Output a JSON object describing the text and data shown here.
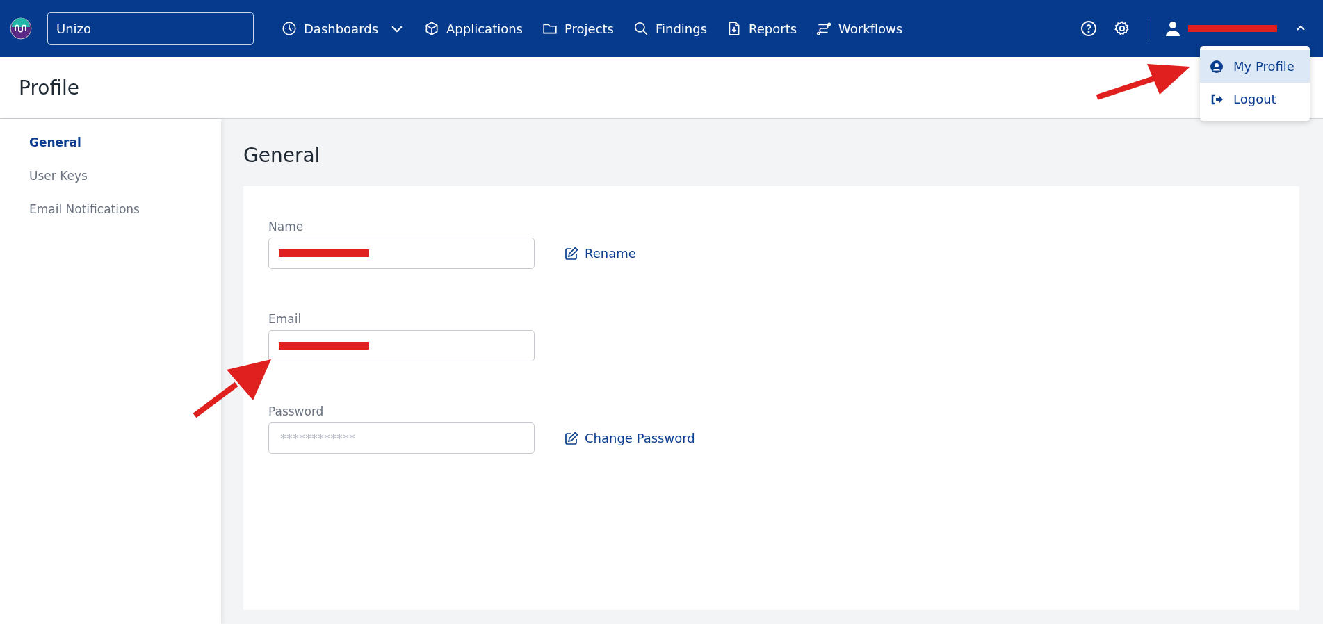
{
  "header": {
    "search": {
      "value": "Unizo"
    },
    "nav": [
      {
        "label": "Dashboards",
        "has_dropdown": true
      },
      {
        "label": "Applications",
        "has_dropdown": false
      },
      {
        "label": "Projects",
        "has_dropdown": false
      },
      {
        "label": "Findings",
        "has_dropdown": false
      },
      {
        "label": "Reports",
        "has_dropdown": false
      },
      {
        "label": "Workflows",
        "has_dropdown": false
      }
    ],
    "user_menu": {
      "name_redacted": true,
      "expanded": true,
      "items": [
        {
          "label": "My Profile",
          "selected": true
        },
        {
          "label": "Logout",
          "selected": false
        }
      ]
    }
  },
  "page_title": "Profile",
  "sidebar": {
    "items": [
      {
        "label": "General",
        "selected": true
      },
      {
        "label": "User Keys",
        "selected": false
      },
      {
        "label": "Email Notifications",
        "selected": false
      }
    ]
  },
  "section_title": "General",
  "fields": [
    {
      "label": "Name",
      "redacted": true,
      "action": "Rename"
    },
    {
      "label": "Email",
      "redacted": true
    },
    {
      "label": "Password",
      "placeholder": "************",
      "redacted": false,
      "action": "Change Password"
    }
  ]
}
